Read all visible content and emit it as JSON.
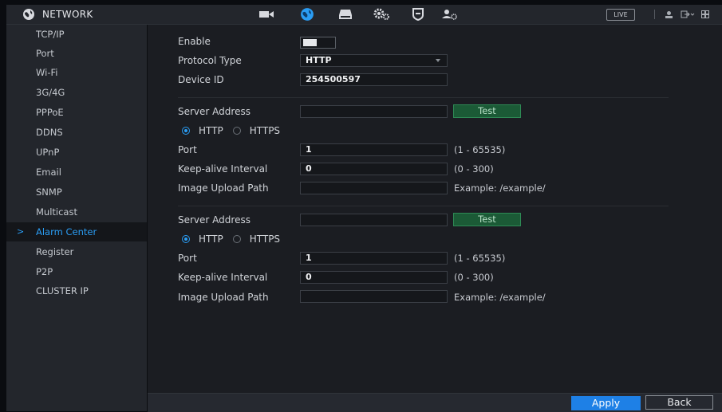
{
  "header": {
    "title": "NETWORK",
    "nav_icons": [
      "camera-icon",
      "network-icon",
      "storage-icon",
      "settings-icon",
      "security-shield-icon",
      "account-icon"
    ],
    "active_nav": "network-icon",
    "live_label": "LIVE",
    "accent_color": "#2a9df4"
  },
  "sidebar": {
    "items": [
      {
        "label": "TCP/IP"
      },
      {
        "label": "Port"
      },
      {
        "label": "Wi-Fi"
      },
      {
        "label": "3G/4G"
      },
      {
        "label": "PPPoE"
      },
      {
        "label": "DDNS"
      },
      {
        "label": "UPnP"
      },
      {
        "label": "Email"
      },
      {
        "label": "SNMP"
      },
      {
        "label": "Multicast"
      },
      {
        "label": "Alarm Center",
        "active": true
      },
      {
        "label": "Register"
      },
      {
        "label": "P2P"
      },
      {
        "label": "CLUSTER IP"
      }
    ],
    "active_marker": ">"
  },
  "form": {
    "enable_label": "Enable",
    "enable_state": true,
    "protocol_label": "Protocol Type",
    "protocol_value": "HTTP",
    "device_id_label": "Device ID",
    "device_id_value": "254500597",
    "servers": [
      {
        "server_address_label": "Server Address",
        "server_address_value": "",
        "test_label": "Test",
        "radio_http": "HTTP",
        "radio_https": "HTTPS",
        "selected": "HTTP",
        "port_label": "Port",
        "port_value": "1",
        "port_hint": "(1 - 65535)",
        "keepalive_label": "Keep-alive Interval",
        "keepalive_value": "0",
        "keepalive_hint": "(0 - 300)",
        "upload_label": "Image Upload Path",
        "upload_value": "",
        "upload_hint": "Example: /example/"
      },
      {
        "server_address_label": "Server Address",
        "server_address_value": "",
        "test_label": "Test",
        "radio_http": "HTTP",
        "radio_https": "HTTPS",
        "selected": "HTTP",
        "port_label": "Port",
        "port_value": "1",
        "port_hint": "(1 - 65535)",
        "keepalive_label": "Keep-alive Interval",
        "keepalive_value": "0",
        "keepalive_hint": "(0 - 300)",
        "upload_label": "Image Upload Path",
        "upload_value": "",
        "upload_hint": "Example: /example/"
      }
    ]
  },
  "footer": {
    "apply_label": "Apply",
    "back_label": "Back"
  }
}
